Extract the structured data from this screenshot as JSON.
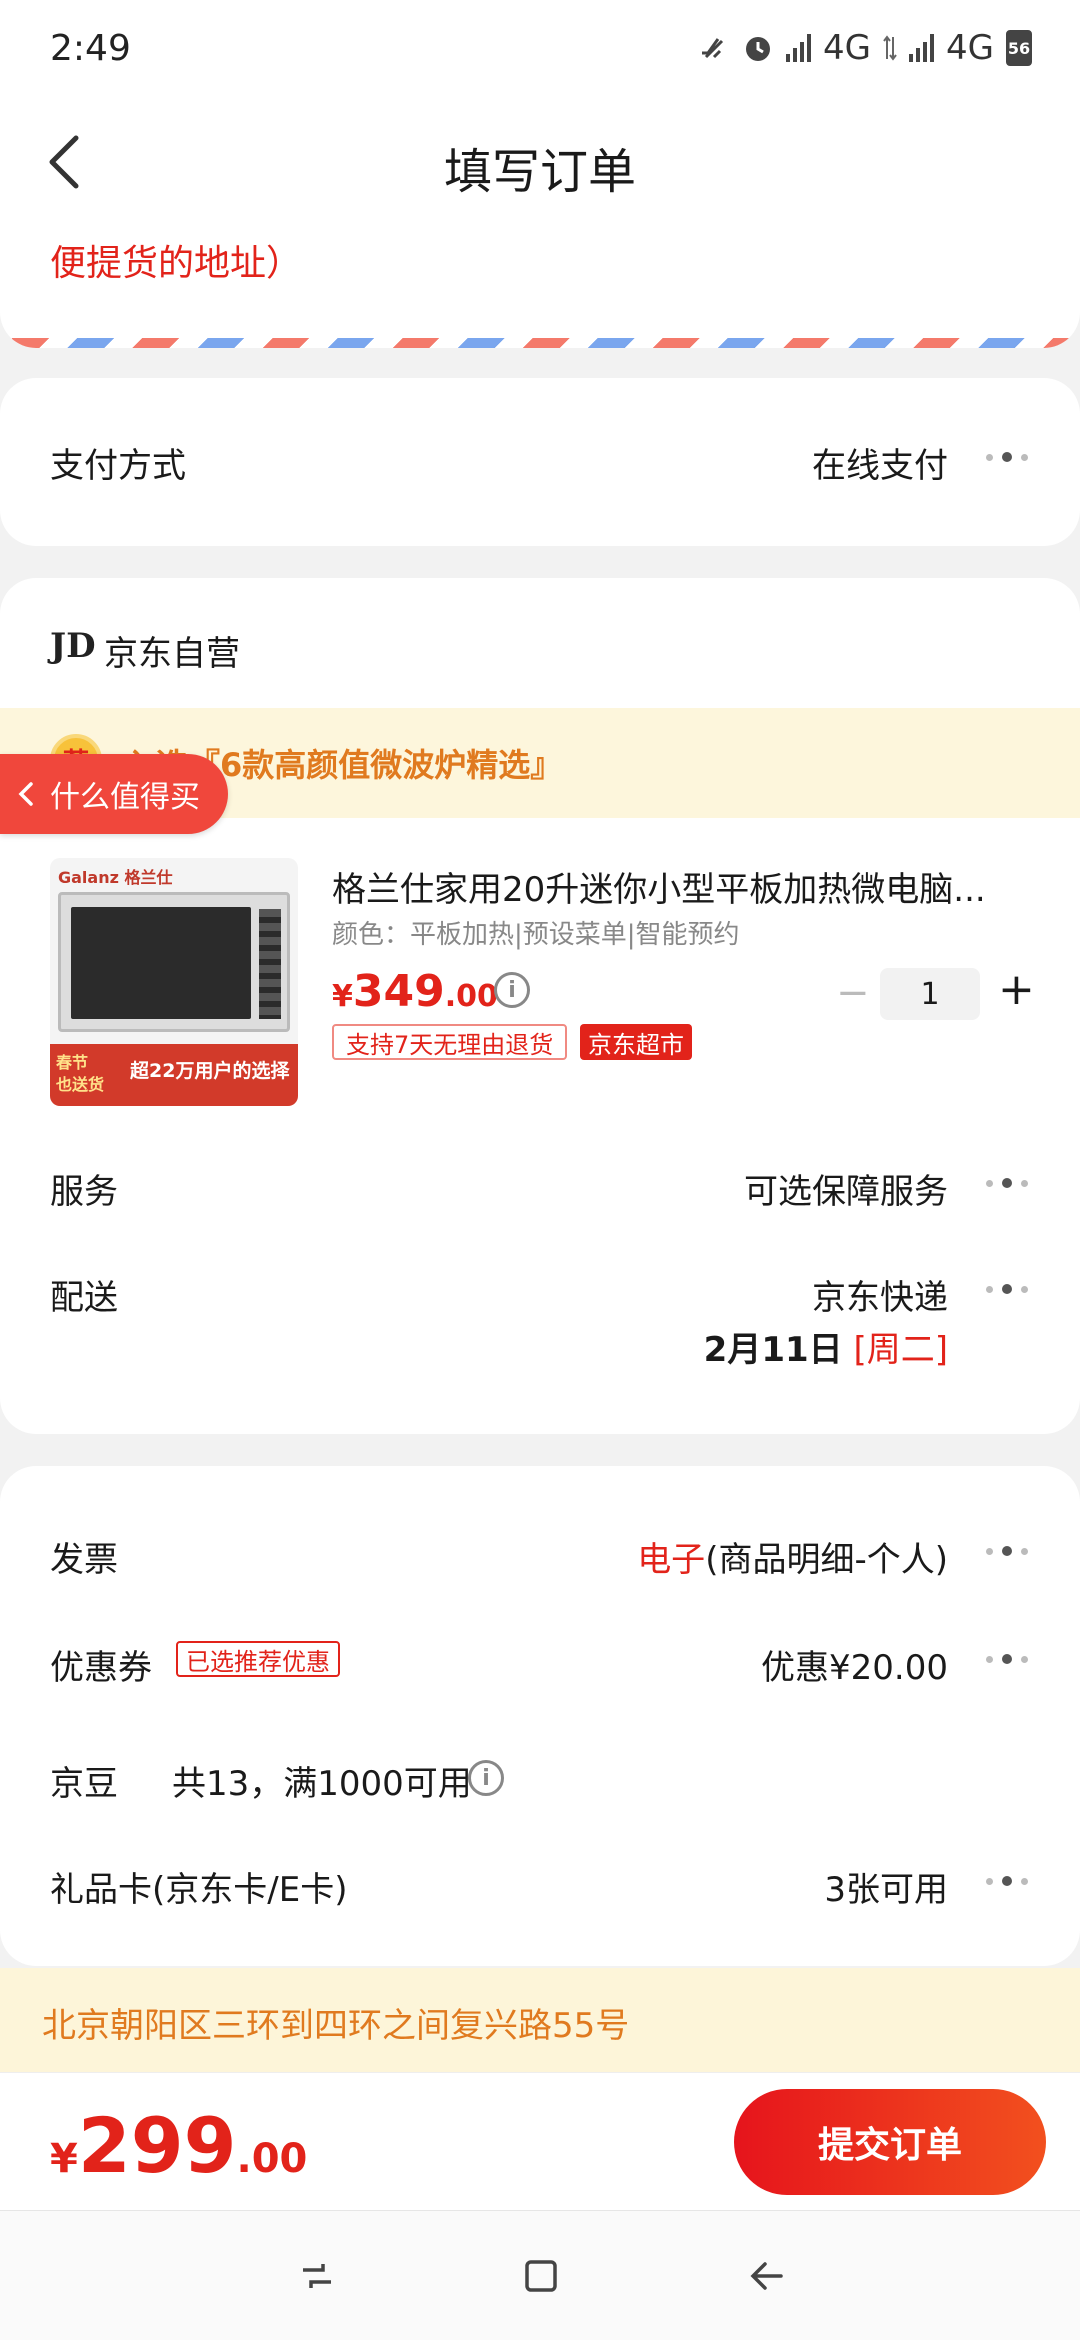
{
  "status_bar": {
    "time": "2:49",
    "network1": "4G",
    "network2": "4G",
    "battery": "56"
  },
  "nav": {
    "title": "填写订单"
  },
  "address": {
    "partial_text": "便提货的地址）"
  },
  "payment": {
    "label": "支付方式",
    "value": "在线支付"
  },
  "shop": {
    "logo": "JD",
    "name": "京东自营"
  },
  "promo": {
    "icon": "荐",
    "text": "入选『6款高颜值微波炉精选』",
    "worth_tag": "什么值得买"
  },
  "product": {
    "image_brand": "Galanz 格兰仕",
    "image_badge_line1": "春节",
    "image_badge_line2": "也送货",
    "image_slogan": "超22万用户的选择",
    "title": "格兰仕家用20升迷你小型平板加热微电脑...",
    "spec": "颜色：平板加热|预设菜单|智能预约",
    "price_symbol": "¥",
    "price_int": "349",
    "price_dec": ".00",
    "quantity": "1",
    "tag_return": "支持7天无理由退货",
    "tag_market": "京东超市"
  },
  "service": {
    "label": "服务",
    "value": "可选保障服务"
  },
  "delivery": {
    "label": "配送",
    "value": "京东快递",
    "date": "2月11日",
    "weekday": "[周二]"
  },
  "invoice": {
    "label": "发票",
    "value_highlight": "电子",
    "value_rest": "(商品明细-个人)"
  },
  "coupon": {
    "label": "优惠券",
    "tag": "已选推荐优惠",
    "value": "优惠¥20.00"
  },
  "beans": {
    "label": "京豆",
    "value": "共13，满1000可用"
  },
  "giftcard": {
    "label": "礼品卡(京东卡/E卡)",
    "value": "3张可用"
  },
  "address_footer": {
    "text": "北京朝阳区三环到四环之间复兴路55号"
  },
  "total": {
    "symbol": "¥",
    "int": "299",
    "dec": ".00"
  },
  "submit": {
    "label": "提交订单"
  },
  "colors": {
    "accent": "#e2231a",
    "promo_text": "#e07a1f",
    "promo_bg": "#fdf6dc",
    "page_bg": "#f2f2f2"
  }
}
